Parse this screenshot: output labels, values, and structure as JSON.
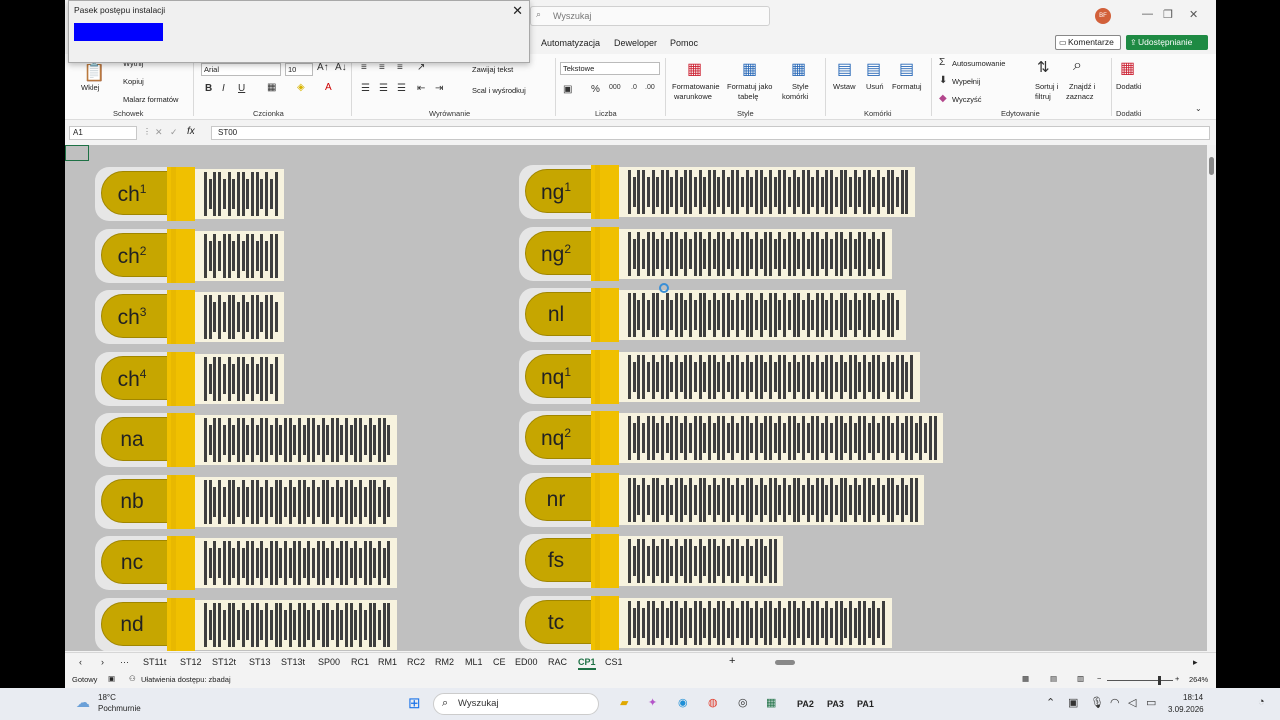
{
  "window": {
    "search_placeholder": "Wyszukaj",
    "avatar_initials": "BF"
  },
  "menu": [
    "Automatyzacja",
    "Deweloper",
    "Pomoc"
  ],
  "header_buttons": {
    "comment": "Komentarze",
    "share": "Udostępnianie"
  },
  "ribbon": {
    "clipboard": {
      "label": "Schowek",
      "paste": "Wklej",
      "cut": "Wytnij",
      "copy": "Kopiuj",
      "painter": "Malarz formatów"
    },
    "font": {
      "label": "Czcionka",
      "family": "Arial",
      "size": "10"
    },
    "alignment": {
      "label": "Wyrównanie",
      "wrap": "Zawijaj tekst",
      "merge": "Scal i wyśrodkuj"
    },
    "number": {
      "label": "Liczba",
      "format": "Tekstowe"
    },
    "styles": {
      "label": "Style",
      "cond1": "Formatowanie",
      "cond2": "warunkowe",
      "table1": "Formatuj jako",
      "table2": "tabelę",
      "cell1": "Style",
      "cell2": "komórki"
    },
    "cells": {
      "label": "Komórki",
      "insert": "Wstaw",
      "delete": "Usuń",
      "format": "Formatuj"
    },
    "editing": {
      "label": "Edytowanie",
      "autosum": "Autosumowanie",
      "fill": "Wypełnij",
      "clear": "Wyczyść",
      "sort1": "Sortuj i",
      "sort2": "filtruj",
      "find1": "Znajdź i",
      "find2": "zaznacz"
    },
    "addins": {
      "label": "Dodatki",
      "button": "Dodatki"
    }
  },
  "formula_bar": {
    "name_box": "A1",
    "fx": "fx",
    "value": "ST00"
  },
  "cards_left": [
    {
      "base": "ch",
      "sup": "1",
      "marks": [
        1,
        0,
        1,
        1,
        0,
        1,
        0,
        1,
        1,
        0,
        1,
        1,
        0,
        1,
        0,
        1
      ]
    },
    {
      "base": "ch",
      "sup": "2",
      "marks": [
        1,
        0,
        1,
        0,
        1,
        1,
        0,
        1,
        0,
        1,
        1,
        0,
        1,
        0,
        1,
        1
      ]
    },
    {
      "base": "ch",
      "sup": "3",
      "marks": [
        1,
        1,
        0,
        1,
        0,
        1,
        1,
        0,
        1,
        0,
        1,
        1,
        0,
        1,
        1,
        0
      ]
    },
    {
      "base": "ch",
      "sup": "4",
      "marks": [
        1,
        0,
        1,
        1,
        0,
        1,
        0,
        1,
        1,
        0,
        1,
        0,
        1,
        1,
        0,
        1
      ]
    },
    {
      "base": "na",
      "sup": "",
      "marks": [
        1,
        0,
        1,
        1,
        0,
        1,
        0,
        1,
        1,
        0,
        1,
        0,
        1,
        1,
        0,
        1,
        0,
        1,
        1,
        0,
        1,
        0,
        1,
        1,
        0,
        1,
        0,
        1,
        1,
        0,
        1,
        0,
        1,
        1,
        0,
        1,
        0,
        1,
        1,
        0
      ]
    },
    {
      "base": "nb",
      "sup": "",
      "marks": [
        1,
        1,
        0,
        1,
        0,
        1,
        1,
        0,
        1,
        0,
        1,
        1,
        0,
        1,
        0,
        1,
        1,
        0,
        1,
        0,
        1,
        1,
        0,
        1,
        0,
        1,
        1,
        0,
        1,
        0,
        1,
        1,
        0,
        1,
        0,
        1,
        1,
        0,
        1,
        0
      ]
    },
    {
      "base": "nc",
      "sup": "",
      "marks": [
        1,
        0,
        1,
        0,
        1,
        1,
        0,
        1,
        0,
        1,
        1,
        0,
        1,
        0,
        1,
        1,
        0,
        1,
        0,
        1,
        1,
        0,
        1,
        0,
        1,
        1,
        0,
        1,
        0,
        1,
        1,
        0,
        1,
        0,
        1,
        1,
        0,
        1,
        0,
        1
      ]
    },
    {
      "base": "nd",
      "sup": "",
      "marks": [
        1,
        0,
        1,
        1,
        0,
        1,
        1,
        0,
        1,
        0,
        1,
        1,
        0,
        1,
        0,
        1,
        1,
        0,
        1,
        0,
        1,
        1,
        0,
        1,
        0,
        1,
        1,
        0,
        1,
        0,
        1,
        1,
        0,
        1,
        0,
        1,
        1,
        0,
        1,
        1
      ]
    }
  ],
  "cards_right": [
    {
      "base": "ng",
      "sup": "1",
      "marks": [
        1,
        0,
        1,
        1,
        0,
        1,
        0,
        1,
        1,
        0,
        1,
        0,
        1,
        1,
        0,
        1,
        0,
        1,
        1,
        0,
        1,
        0,
        1,
        1,
        0,
        1,
        0,
        1,
        1,
        0,
        1,
        0,
        1,
        1,
        0,
        1,
        0,
        1,
        1,
        0,
        1,
        0,
        1,
        1,
        0,
        1,
        1,
        0,
        1,
        0,
        1,
        1,
        0,
        1,
        0,
        1,
        1,
        0,
        1,
        1
      ]
    },
    {
      "base": "ng",
      "sup": "2",
      "marks": [
        1,
        0,
        1,
        0,
        1,
        1,
        0,
        1,
        0,
        1,
        1,
        0,
        1,
        0,
        1,
        1,
        0,
        1,
        0,
        1,
        1,
        0,
        1,
        0,
        1,
        1,
        0,
        1,
        0,
        1,
        1,
        0,
        1,
        0,
        1,
        1,
        0,
        1,
        0,
        1,
        1,
        0,
        1,
        0,
        1,
        1,
        0,
        1,
        0,
        1,
        1,
        0,
        1,
        0,
        1
      ]
    },
    {
      "base": "nl",
      "sup": "",
      "marks": [
        1,
        1,
        0,
        1,
        0,
        1,
        1,
        0,
        1,
        0,
        1,
        1,
        0,
        1,
        0,
        1,
        1,
        0,
        1,
        0,
        1,
        1,
        0,
        1,
        0,
        1,
        1,
        0,
        1,
        0,
        1,
        1,
        0,
        1,
        0,
        1,
        1,
        0,
        1,
        0,
        1,
        1,
        0,
        1,
        0,
        1,
        1,
        0,
        1,
        0,
        1,
        1,
        0,
        1,
        0,
        1,
        1,
        0
      ]
    },
    {
      "base": "nq",
      "sup": "1",
      "marks": [
        1,
        0,
        1,
        1,
        0,
        1,
        0,
        1,
        1,
        0,
        1,
        0,
        1,
        1,
        0,
        1,
        0,
        1,
        1,
        0,
        1,
        0,
        1,
        1,
        0,
        1,
        0,
        1,
        1,
        0,
        1,
        0,
        1,
        1,
        0,
        1,
        0,
        1,
        1,
        0,
        1,
        0,
        1,
        1,
        0,
        1,
        0,
        1,
        1,
        0,
        1,
        0,
        1,
        1,
        0,
        1,
        0,
        1,
        1,
        0,
        1
      ]
    },
    {
      "base": "nq",
      "sup": "2",
      "marks": [
        1,
        0,
        1,
        0,
        1,
        1,
        0,
        1,
        0,
        1,
        1,
        0,
        1,
        0,
        1,
        1,
        0,
        1,
        0,
        1,
        1,
        0,
        1,
        0,
        1,
        1,
        0,
        1,
        0,
        1,
        1,
        0,
        1,
        0,
        1,
        1,
        0,
        1,
        0,
        1,
        1,
        0,
        1,
        0,
        1,
        1,
        0,
        1,
        0,
        1,
        1,
        0,
        1,
        0,
        1,
        1,
        0,
        1,
        0,
        1,
        1,
        0,
        1,
        0,
        1,
        1
      ]
    },
    {
      "base": "nr",
      "sup": "",
      "marks": [
        1,
        1,
        0,
        1,
        0,
        1,
        1,
        0,
        1,
        0,
        1,
        1,
        0,
        1,
        0,
        1,
        1,
        0,
        1,
        0,
        1,
        1,
        0,
        1,
        0,
        1,
        1,
        0,
        1,
        0,
        1,
        1,
        0,
        1,
        0,
        1,
        1,
        0,
        1,
        0,
        1,
        1,
        0,
        1,
        0,
        1,
        1,
        0,
        1,
        0,
        1,
        1,
        0,
        1,
        0,
        1,
        1,
        0,
        1,
        0,
        1,
        1
      ]
    },
    {
      "base": "fs",
      "sup": "",
      "marks": [
        1,
        0,
        1,
        1,
        0,
        1,
        0,
        1,
        1,
        0,
        1,
        0,
        1,
        1,
        0,
        1,
        0,
        1,
        1,
        0,
        1,
        0,
        1,
        1,
        0,
        1,
        0,
        1,
        1,
        0,
        1,
        1
      ]
    },
    {
      "base": "tc",
      "sup": "",
      "marks": [
        1,
        0,
        1,
        0,
        1,
        1,
        0,
        1,
        0,
        1,
        1,
        0,
        1,
        0,
        1,
        1,
        0,
        1,
        0,
        1,
        1,
        0,
        1,
        0,
        1,
        1,
        0,
        1,
        0,
        1,
        1,
        0,
        1,
        0,
        1,
        1,
        0,
        1,
        0,
        1,
        1,
        0,
        1,
        0,
        1,
        1,
        0,
        1,
        0,
        1,
        1,
        0,
        1,
        0,
        1
      ]
    }
  ],
  "sheet_tabs": [
    "ST11t",
    "ST12",
    "ST12t",
    "ST13",
    "ST13t",
    "SP00",
    "RC1",
    "RM1",
    "RC2",
    "RM2",
    "ML1",
    "CE",
    "ED00",
    "RAC",
    "CP1",
    "CS1"
  ],
  "active_tab": "CP1",
  "status": {
    "ready": "Gotowy",
    "accessibility": "Ułatwienia dostępu: zbadaj",
    "zoom": "264%"
  },
  "taskbar": {
    "temp": "18°C",
    "weather": "Pochmurnie",
    "search": "Wyszukaj",
    "pin1": "PA2",
    "pin2": "PA3",
    "pin3": "PA1",
    "time": "18:14",
    "date": "3.09.2026"
  },
  "dialog": {
    "title": "Pasek postępu instalacji"
  },
  "colors": {
    "accent": "#1e7145",
    "pill": "#c6a600",
    "yellow": "#f0c000",
    "progress": "#0000ff"
  }
}
